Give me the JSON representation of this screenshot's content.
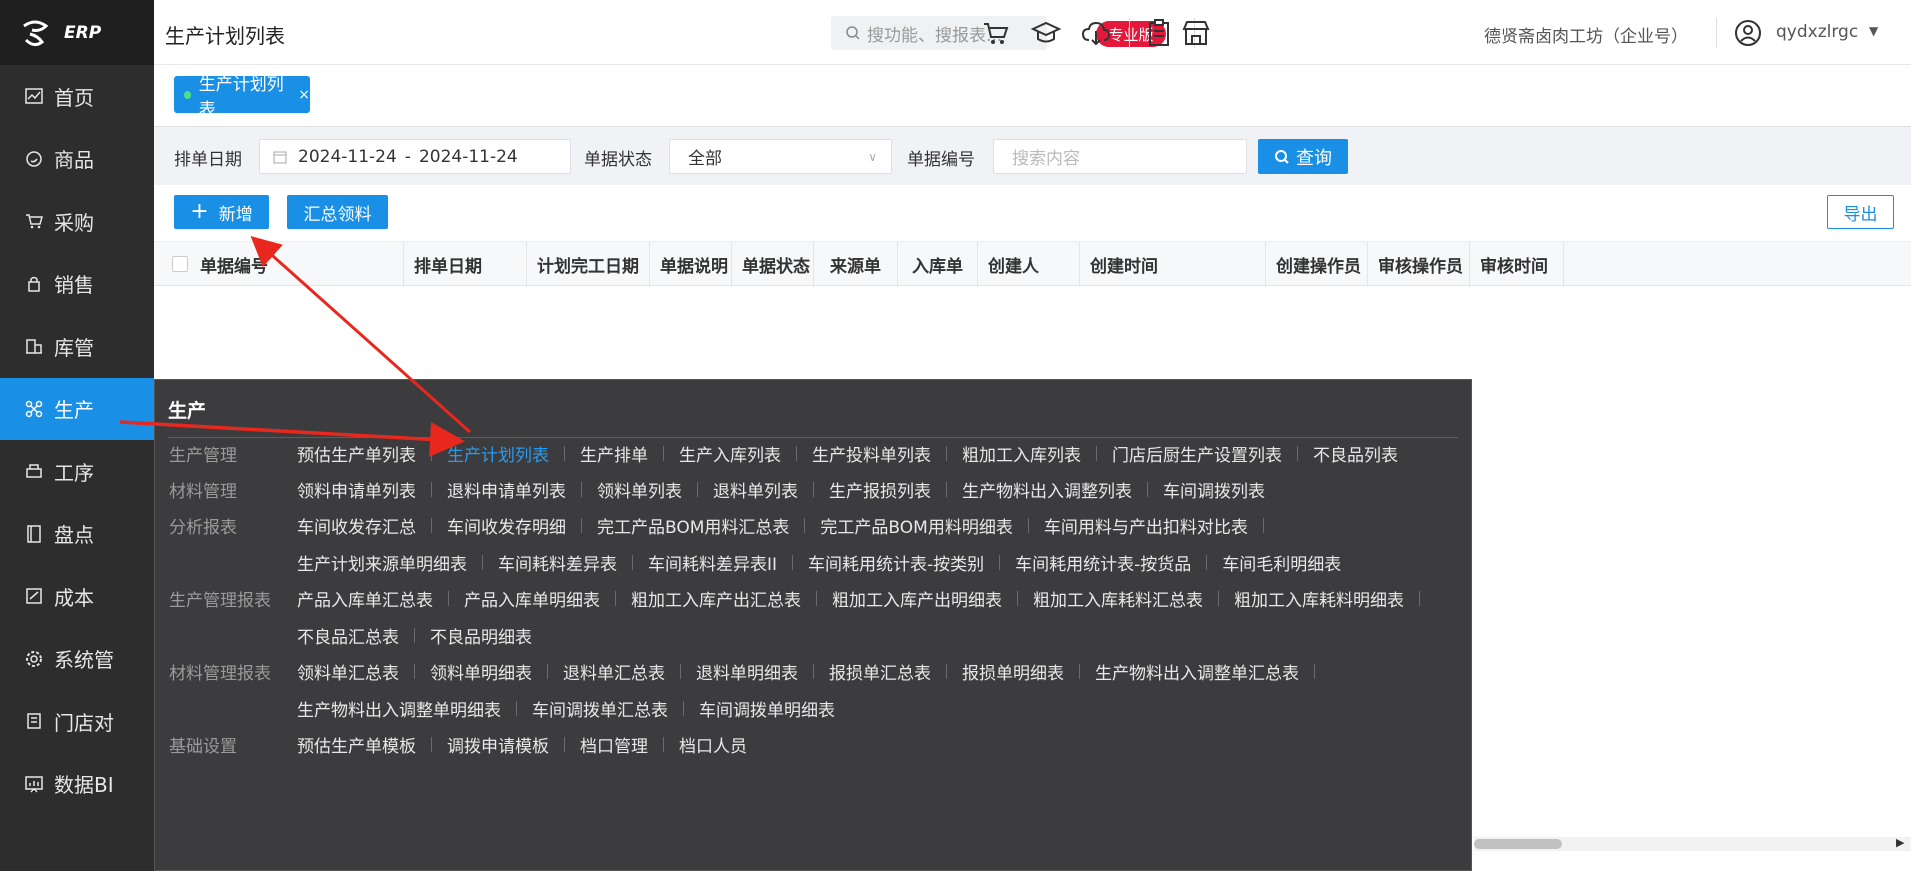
{
  "app": {
    "logo_text": "ERP"
  },
  "sidebar": {
    "items": [
      {
        "label": "首页",
        "icon": "dashboard-icon"
      },
      {
        "label": "商品",
        "icon": "goods-icon"
      },
      {
        "label": "采购",
        "icon": "cart-icon"
      },
      {
        "label": "销售",
        "icon": "sales-icon"
      },
      {
        "label": "库管",
        "icon": "warehouse-icon"
      },
      {
        "label": "生产",
        "icon": "production-icon"
      },
      {
        "label": "工序",
        "icon": "process-icon"
      },
      {
        "label": "盘点",
        "icon": "inventory-icon"
      },
      {
        "label": "成本",
        "icon": "cost-icon"
      },
      {
        "label": "系统管",
        "icon": "settings-icon"
      },
      {
        "label": "门店对",
        "icon": "store-icon"
      },
      {
        "label": "数据BI",
        "icon": "chart-icon"
      }
    ],
    "active_index": 5
  },
  "header": {
    "title": "生产计划列表",
    "search_placeholder": "搜功能、搜报表...",
    "badge": "专业版",
    "company": "德贤斋卤肉工坊（企业号）",
    "username": "qydxzlrgc"
  },
  "tabs": [
    {
      "label": "生产计划列表",
      "close": "×"
    }
  ],
  "filter": {
    "date_label": "排单日期",
    "date_start": "2024-11-24",
    "date_sep": "-",
    "date_end": "2024-11-24",
    "status_label": "单据状态",
    "status_value": "全部",
    "code_label": "单据编号",
    "code_placeholder": "搜索内容",
    "query_label": "查询"
  },
  "toolbar": {
    "add_label": "新增",
    "summary_label": "汇总领料",
    "export_label": "导出"
  },
  "table": {
    "columns": [
      "单据编号",
      "排单日期",
      "计划完工日期",
      "单据说明",
      "单据状态",
      "来源单",
      "入库单",
      "创建人",
      "创建时间",
      "创建操作员",
      "审核操作员",
      "审核时间"
    ]
  },
  "menu": {
    "title": "生产",
    "rows": [
      {
        "category": "生产管理",
        "links": [
          "预估生产单列表",
          "生产计划列表",
          "生产排单",
          "生产入库列表",
          "生产投料单列表",
          "粗加工入库列表",
          "门店后厨生产设置列表",
          "不良品列表"
        ],
        "active": 1
      },
      {
        "category": "材料管理",
        "links": [
          "领料申请单列表",
          "退料申请单列表",
          "领料单列表",
          "退料单列表",
          "生产报损列表",
          "生产物料出入调整列表",
          "车间调拨列表"
        ]
      },
      {
        "category": "分析报表",
        "links": [
          "车间收发存汇总",
          "车间收发存明细",
          "完工产品BOM用料汇总表",
          "完工产品BOM用料明细表",
          "车间用料与产出扣料对比表"
        ]
      },
      {
        "category": "",
        "links": [
          "生产计划来源单明细表",
          "车间耗料差异表",
          "车间耗料差异表II",
          "车间耗用统计表-按类别",
          "车间耗用统计表-按货品",
          "车间毛利明细表"
        ]
      },
      {
        "category": "生产管理报表",
        "links": [
          "产品入库单汇总表",
          "产品入库单明细表",
          "粗加工入库产出汇总表",
          "粗加工入库产出明细表",
          "粗加工入库耗料汇总表",
          "粗加工入库耗料明细表"
        ]
      },
      {
        "category": "",
        "links": [
          "不良品汇总表",
          "不良品明细表"
        ]
      },
      {
        "category": "材料管理报表",
        "links": [
          "领料单汇总表",
          "领料单明细表",
          "退料单汇总表",
          "退料单明细表",
          "报损单汇总表",
          "报损单明细表",
          "生产物料出入调整单汇总表"
        ]
      },
      {
        "category": "",
        "links": [
          "生产物料出入调整单明细表",
          "车间调拨单汇总表",
          "车间调拨单明细表"
        ]
      },
      {
        "category": "基础设置",
        "links": [
          "预估生产单模板",
          "调拨申请模板",
          "档口管理",
          "档口人员"
        ]
      }
    ]
  },
  "colors": {
    "primary": "#1a8fe6",
    "sidebar_bg": "#2d2d2d",
    "menu_bg": "#3c3c3e",
    "badge": "#e4183a",
    "annotation_arrow": "#e8281e"
  }
}
